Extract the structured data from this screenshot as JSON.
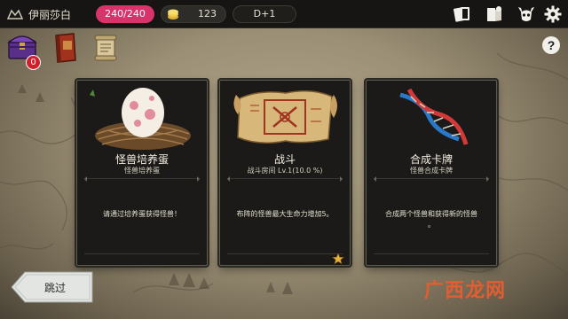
{
  "player": {
    "name": "伊丽莎白"
  },
  "stats": {
    "hp": "240/240",
    "gold": "123",
    "day": "D+1"
  },
  "resources": {
    "chest_badge": "0"
  },
  "help": {
    "label": "?"
  },
  "cards": [
    {
      "title": "怪兽培养蛋",
      "subtitle": "怪兽培养蛋",
      "description": "请通过培养蛋获得怪兽！",
      "extra": "",
      "icon": "monster-egg-nest"
    },
    {
      "title": "战斗",
      "subtitle": "战斗房间 Lv.1(10.0 %)",
      "description": "布阵的怪兽最大生命力增加5。",
      "extra": "",
      "icon": "battle-scroll",
      "starred": true
    },
    {
      "title": "合成卡牌",
      "subtitle": "怪兽合成卡牌",
      "description": "合成两个怪兽和获得新的怪兽",
      "extra": "。",
      "icon": "dna-helix"
    }
  ],
  "skip": {
    "label": "跳过"
  },
  "watermark": {
    "text": "广西龙网"
  },
  "colors": {
    "hp": "#d8336a",
    "badge": "#d21f2d",
    "topbar": "#161513"
  }
}
